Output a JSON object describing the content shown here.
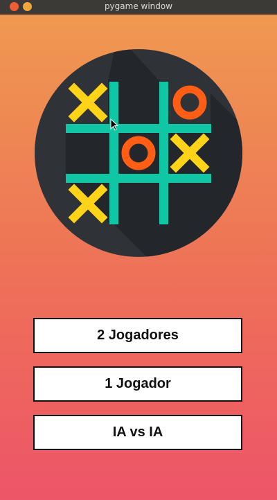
{
  "window": {
    "title": "pygame window"
  },
  "logo": {
    "board": [
      [
        "X",
        "",
        "O"
      ],
      [
        "",
        "O",
        "X"
      ],
      [
        "X",
        "",
        ""
      ]
    ],
    "colors": {
      "circle": "#2f3337",
      "shadow": "#23262a",
      "grid": "#11c6a4",
      "x_mark": "#ffd318",
      "o_mark": "#ff5e14"
    }
  },
  "menu": {
    "two_players": "2 Jogadores",
    "one_player": "1 Jogador",
    "ai_vs_ai": "IA vs IA"
  },
  "background": {
    "top_color": "#ef9950",
    "bottom_color": "#ed5568"
  }
}
